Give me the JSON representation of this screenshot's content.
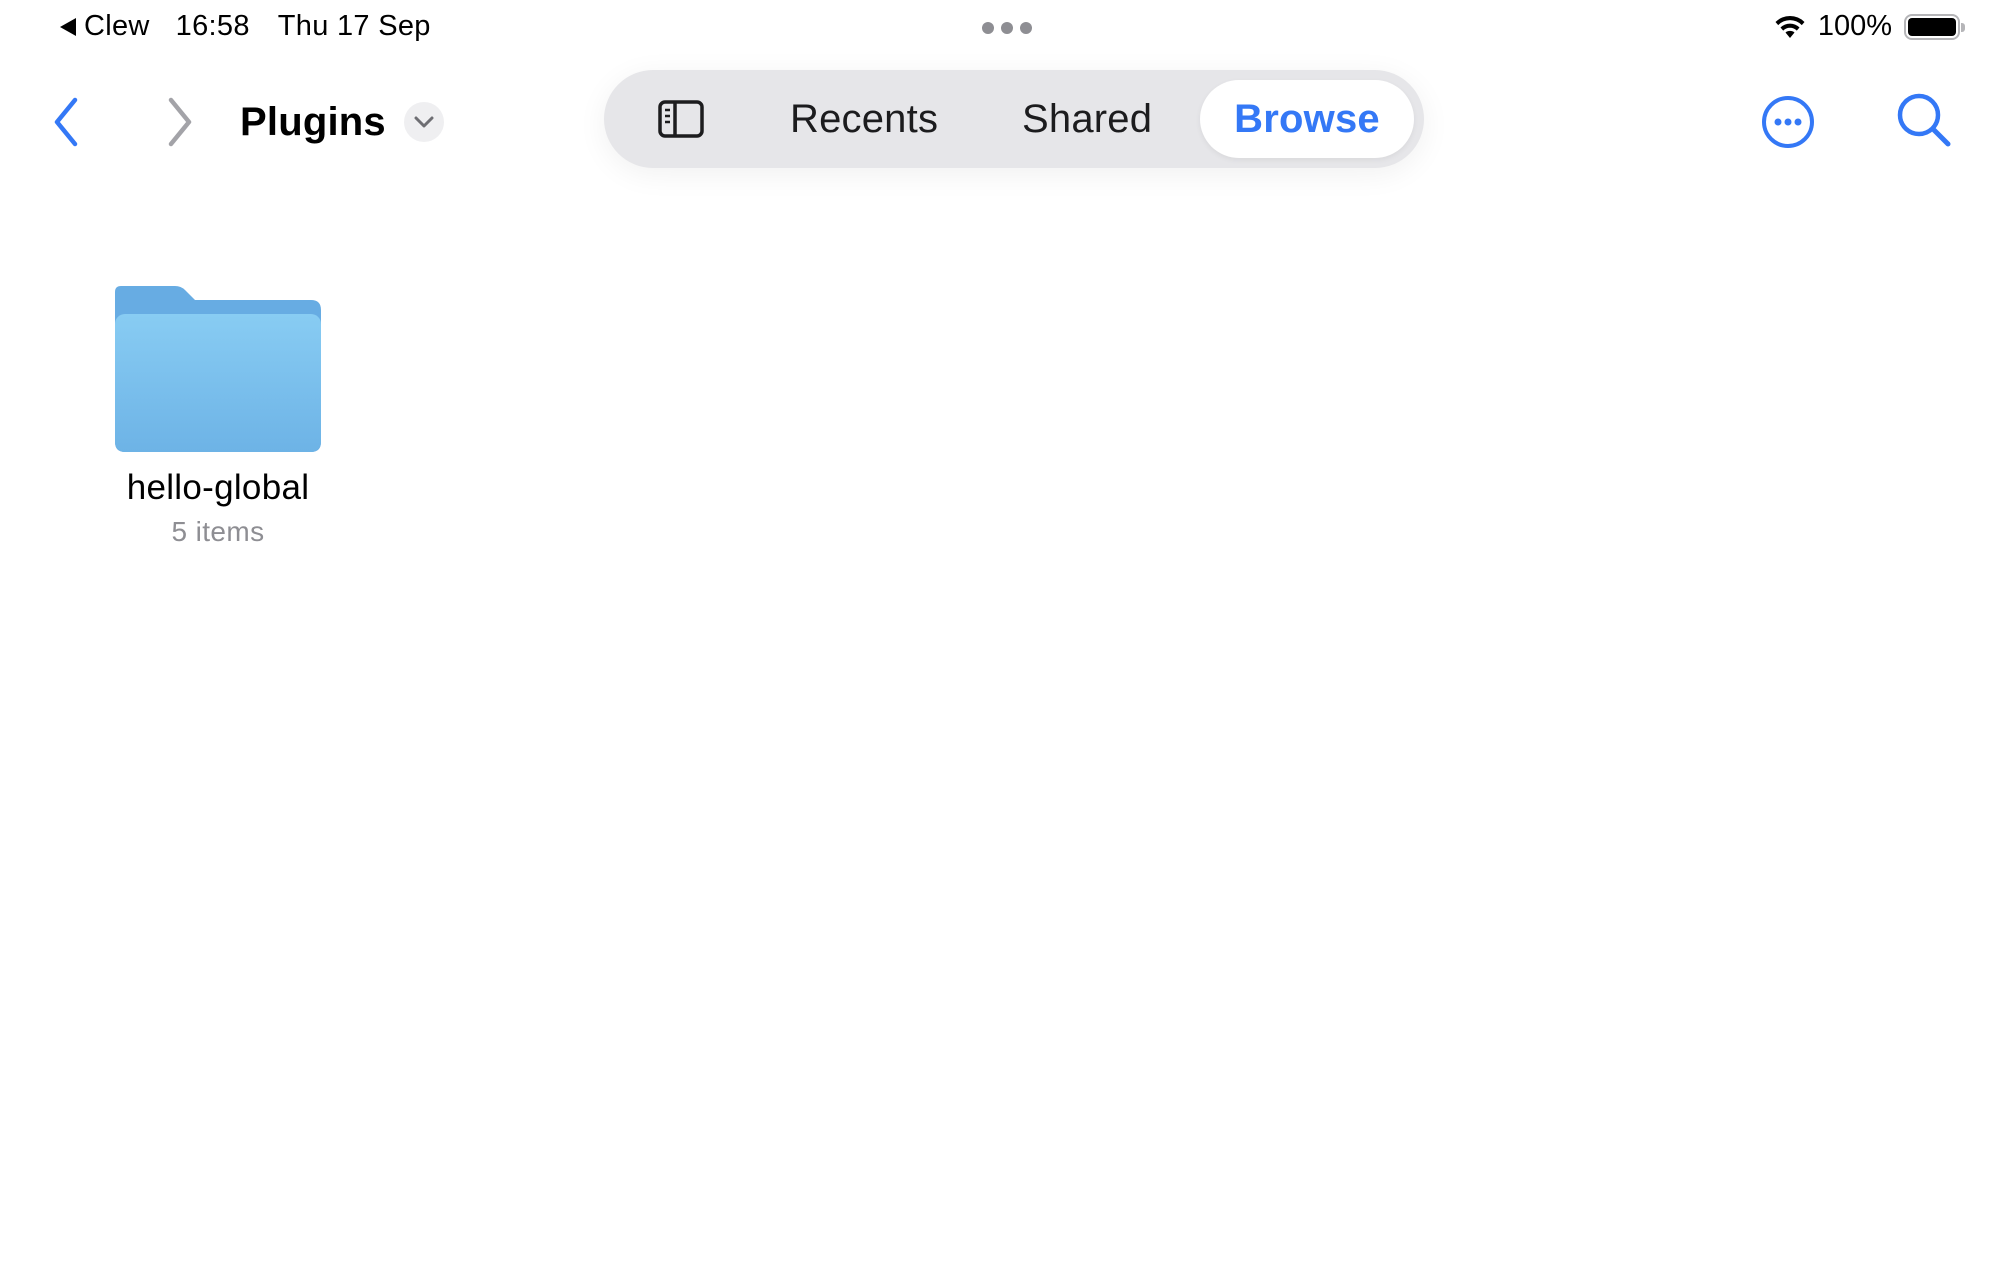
{
  "status_bar": {
    "back_app": "Clew",
    "time": "16:58",
    "date": "Thu 17 Sep",
    "battery_percent": "100%",
    "battery_level": 1.0,
    "wifi_icon": "wifi-icon",
    "multitask_icon": "multitasking-dots-icon"
  },
  "toolbar": {
    "back_icon": "chevron-left-icon",
    "forward_icon": "chevron-right-icon",
    "folder_title": "Plugins",
    "title_menu_icon": "chevron-down-icon",
    "sidebar_icon": "sidebar-icon",
    "tabs": [
      {
        "label": "Recents",
        "selected": false
      },
      {
        "label": "Shared",
        "selected": false
      },
      {
        "label": "Browse",
        "selected": true
      }
    ],
    "more_icon": "ellipsis-circle-icon",
    "search_icon": "magnifying-glass-icon"
  },
  "content": {
    "items": [
      {
        "name": "hello-global",
        "meta": "5 items",
        "icon": "folder-icon"
      }
    ]
  },
  "colors": {
    "accent": "#3478f6",
    "folder_light": "#85c5f0",
    "folder_dark": "#6aaee3",
    "secondary_text": "#8e8e93",
    "segment_background": "#e6e6e9"
  }
}
